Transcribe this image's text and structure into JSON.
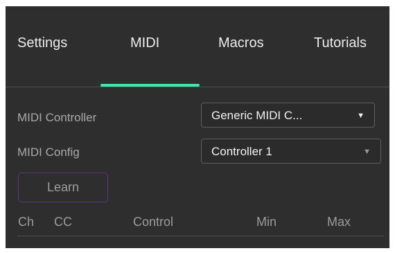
{
  "tabs": [
    {
      "label": "Settings",
      "active": false
    },
    {
      "label": "MIDI",
      "active": true
    },
    {
      "label": "Macros",
      "active": false
    },
    {
      "label": "Tutorials",
      "active": false
    }
  ],
  "colors": {
    "accent": "#3ee8a8",
    "panel_background": "#2e2e2e",
    "learn_border": "#5b3a78"
  },
  "midi": {
    "controller_label": "MIDI Controller",
    "controller_value": "Generic MIDI C...",
    "config_label": "MIDI Config",
    "config_value": "Controller 1",
    "learn_label": "Learn"
  },
  "table": {
    "columns": [
      "Ch",
      "CC",
      "Control",
      "Min",
      "Max"
    ],
    "rows": []
  },
  "icons": {
    "dropdown": "chevron-down-icon"
  }
}
